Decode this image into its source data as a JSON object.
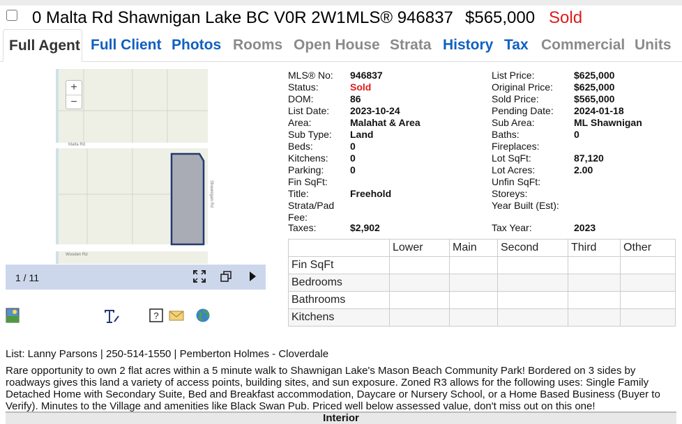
{
  "header": {
    "address": "0 Malta Rd Shawnigan Lake BC V0R 2W1",
    "mls": "MLS® 946837",
    "price": "$565,000",
    "status": "Sold"
  },
  "tabs": [
    {
      "label": "Full Agent"
    },
    {
      "label": "Full Client"
    },
    {
      "label": "Photos"
    },
    {
      "label": "Rooms"
    },
    {
      "label": "Open House"
    },
    {
      "label": "Strata"
    },
    {
      "label": "History"
    },
    {
      "label": "Tax"
    },
    {
      "label": "Commercial"
    },
    {
      "label": "Units"
    }
  ],
  "map": {
    "zoom_in": "+",
    "zoom_out": "−",
    "street_top": "Malta Rd",
    "street_right": "Shawnigan Rd",
    "street_bottom": "Wooden Rd"
  },
  "viewer": {
    "counter": "1 / 11"
  },
  "facts_left": [
    {
      "label": "MLS® No:",
      "value": "946837"
    },
    {
      "label": "Status:",
      "value": "Sold"
    },
    {
      "label": "DOM:",
      "value": "86"
    },
    {
      "label": "List Date:",
      "value": "2023-10-24"
    },
    {
      "label": "Area:",
      "value": "Malahat & Area"
    },
    {
      "label": "Sub Type:",
      "value": "Land"
    },
    {
      "label": "Beds:",
      "value": "0"
    },
    {
      "label": "Kitchens:",
      "value": "0"
    },
    {
      "label": "Parking:",
      "value": "0"
    },
    {
      "label": "Fin SqFt:",
      "value": ""
    },
    {
      "label": "Title:",
      "value": "Freehold"
    },
    {
      "label": "Strata/Pad",
      "value": ""
    },
    {
      "label": "Fee:",
      "value": ""
    },
    {
      "label": "Taxes:",
      "value": "$2,902"
    }
  ],
  "facts_right": [
    {
      "label": "List Price:",
      "value": "$625,000"
    },
    {
      "label": "Original Price:",
      "value": "$625,000"
    },
    {
      "label": "Sold Price:",
      "value": "$565,000"
    },
    {
      "label": "Pending Date:",
      "value": "2024-01-18"
    },
    {
      "label": "Sub Area:",
      "value": "ML Shawnigan"
    },
    {
      "label": "Baths:",
      "value": "0"
    },
    {
      "label": "Fireplaces:",
      "value": ""
    },
    {
      "label": "Lot SqFt:",
      "value": "87,120"
    },
    {
      "label": "Lot Acres:",
      "value": "2.00"
    },
    {
      "label": "Unfin SqFt:",
      "value": ""
    },
    {
      "label": "Storeys:",
      "value": ""
    },
    {
      "label": "Year Built (Est):",
      "value": ""
    },
    {
      "label": "",
      "value": ""
    },
    {
      "label": "Tax Year:",
      "value": "2023"
    }
  ],
  "rooms_table": {
    "columns": [
      "",
      "Lower",
      "Main",
      "Second",
      "Third",
      "Other"
    ],
    "rows": [
      "Fin SqFt",
      "Bedrooms",
      "Bathrooms",
      "Kitchens"
    ]
  },
  "list_line": "List: Lanny Parsons | 250-514-1550 | Pemberton Holmes - Cloverdale",
  "description": "Rare opportunity to own 2 flat acres within a 5 minute walk to Shawnigan Lake's Mason Beach Community Park! Bordered on 3 sides by roadways gives this land a variety of access points, building sites, and sun exposure. Zoned R3 allows for the following uses: Single Family Detached Home with Secondary Suite, Bed and Breakfast accommodation, Daycare or Nursery School, or a Home Based Business (Buyer to Verify). Minutes to the Village and amenities like Black Swan Pub. Priced well below assessed value, don't miss out on this one!",
  "section_header": "Interior",
  "colors": {
    "link": "#1060c0",
    "sold": "#e01b1b",
    "dim_tab": "#8a8a8a",
    "viewer_bar": "#cdd7ec"
  }
}
